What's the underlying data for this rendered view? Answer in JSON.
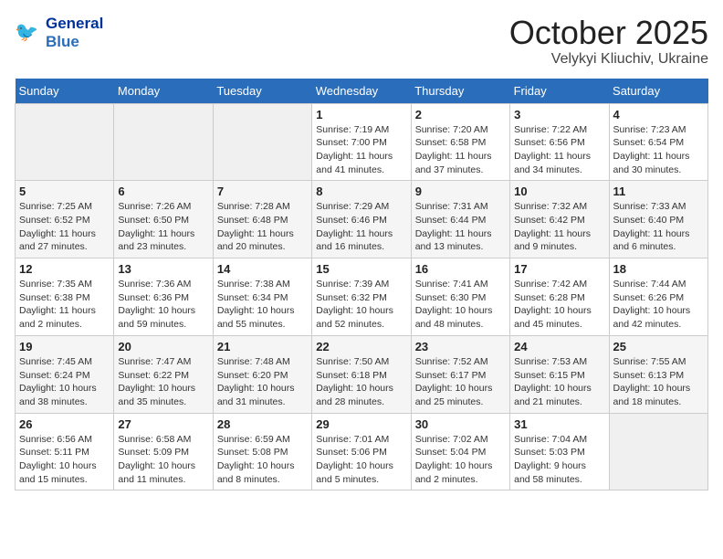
{
  "header": {
    "logo_line1": "General",
    "logo_line2": "Blue",
    "month": "October 2025",
    "location": "Velykyi Kliuchiv, Ukraine"
  },
  "weekdays": [
    "Sunday",
    "Monday",
    "Tuesday",
    "Wednesday",
    "Thursday",
    "Friday",
    "Saturday"
  ],
  "weeks": [
    [
      {
        "day": "",
        "info": ""
      },
      {
        "day": "",
        "info": ""
      },
      {
        "day": "",
        "info": ""
      },
      {
        "day": "1",
        "info": "Sunrise: 7:19 AM\nSunset: 7:00 PM\nDaylight: 11 hours\nand 41 minutes."
      },
      {
        "day": "2",
        "info": "Sunrise: 7:20 AM\nSunset: 6:58 PM\nDaylight: 11 hours\nand 37 minutes."
      },
      {
        "day": "3",
        "info": "Sunrise: 7:22 AM\nSunset: 6:56 PM\nDaylight: 11 hours\nand 34 minutes."
      },
      {
        "day": "4",
        "info": "Sunrise: 7:23 AM\nSunset: 6:54 PM\nDaylight: 11 hours\nand 30 minutes."
      }
    ],
    [
      {
        "day": "5",
        "info": "Sunrise: 7:25 AM\nSunset: 6:52 PM\nDaylight: 11 hours\nand 27 minutes."
      },
      {
        "day": "6",
        "info": "Sunrise: 7:26 AM\nSunset: 6:50 PM\nDaylight: 11 hours\nand 23 minutes."
      },
      {
        "day": "7",
        "info": "Sunrise: 7:28 AM\nSunset: 6:48 PM\nDaylight: 11 hours\nand 20 minutes."
      },
      {
        "day": "8",
        "info": "Sunrise: 7:29 AM\nSunset: 6:46 PM\nDaylight: 11 hours\nand 16 minutes."
      },
      {
        "day": "9",
        "info": "Sunrise: 7:31 AM\nSunset: 6:44 PM\nDaylight: 11 hours\nand 13 minutes."
      },
      {
        "day": "10",
        "info": "Sunrise: 7:32 AM\nSunset: 6:42 PM\nDaylight: 11 hours\nand 9 minutes."
      },
      {
        "day": "11",
        "info": "Sunrise: 7:33 AM\nSunset: 6:40 PM\nDaylight: 11 hours\nand 6 minutes."
      }
    ],
    [
      {
        "day": "12",
        "info": "Sunrise: 7:35 AM\nSunset: 6:38 PM\nDaylight: 11 hours\nand 2 minutes."
      },
      {
        "day": "13",
        "info": "Sunrise: 7:36 AM\nSunset: 6:36 PM\nDaylight: 10 hours\nand 59 minutes."
      },
      {
        "day": "14",
        "info": "Sunrise: 7:38 AM\nSunset: 6:34 PM\nDaylight: 10 hours\nand 55 minutes."
      },
      {
        "day": "15",
        "info": "Sunrise: 7:39 AM\nSunset: 6:32 PM\nDaylight: 10 hours\nand 52 minutes."
      },
      {
        "day": "16",
        "info": "Sunrise: 7:41 AM\nSunset: 6:30 PM\nDaylight: 10 hours\nand 48 minutes."
      },
      {
        "day": "17",
        "info": "Sunrise: 7:42 AM\nSunset: 6:28 PM\nDaylight: 10 hours\nand 45 minutes."
      },
      {
        "day": "18",
        "info": "Sunrise: 7:44 AM\nSunset: 6:26 PM\nDaylight: 10 hours\nand 42 minutes."
      }
    ],
    [
      {
        "day": "19",
        "info": "Sunrise: 7:45 AM\nSunset: 6:24 PM\nDaylight: 10 hours\nand 38 minutes."
      },
      {
        "day": "20",
        "info": "Sunrise: 7:47 AM\nSunset: 6:22 PM\nDaylight: 10 hours\nand 35 minutes."
      },
      {
        "day": "21",
        "info": "Sunrise: 7:48 AM\nSunset: 6:20 PM\nDaylight: 10 hours\nand 31 minutes."
      },
      {
        "day": "22",
        "info": "Sunrise: 7:50 AM\nSunset: 6:18 PM\nDaylight: 10 hours\nand 28 minutes."
      },
      {
        "day": "23",
        "info": "Sunrise: 7:52 AM\nSunset: 6:17 PM\nDaylight: 10 hours\nand 25 minutes."
      },
      {
        "day": "24",
        "info": "Sunrise: 7:53 AM\nSunset: 6:15 PM\nDaylight: 10 hours\nand 21 minutes."
      },
      {
        "day": "25",
        "info": "Sunrise: 7:55 AM\nSunset: 6:13 PM\nDaylight: 10 hours\nand 18 minutes."
      }
    ],
    [
      {
        "day": "26",
        "info": "Sunrise: 6:56 AM\nSunset: 5:11 PM\nDaylight: 10 hours\nand 15 minutes."
      },
      {
        "day": "27",
        "info": "Sunrise: 6:58 AM\nSunset: 5:09 PM\nDaylight: 10 hours\nand 11 minutes."
      },
      {
        "day": "28",
        "info": "Sunrise: 6:59 AM\nSunset: 5:08 PM\nDaylight: 10 hours\nand 8 minutes."
      },
      {
        "day": "29",
        "info": "Sunrise: 7:01 AM\nSunset: 5:06 PM\nDaylight: 10 hours\nand 5 minutes."
      },
      {
        "day": "30",
        "info": "Sunrise: 7:02 AM\nSunset: 5:04 PM\nDaylight: 10 hours\nand 2 minutes."
      },
      {
        "day": "31",
        "info": "Sunrise: 7:04 AM\nSunset: 5:03 PM\nDaylight: 9 hours\nand 58 minutes."
      },
      {
        "day": "",
        "info": ""
      }
    ]
  ]
}
